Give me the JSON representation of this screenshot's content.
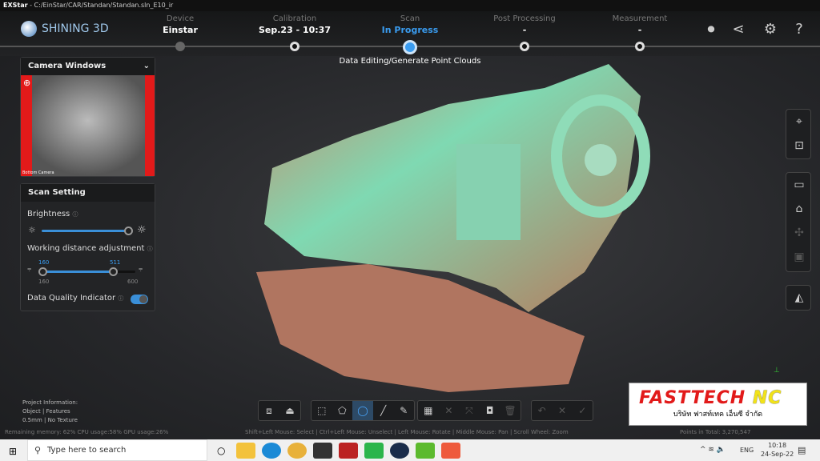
{
  "window": {
    "app": "EXStar",
    "path": "- C:/EinStar/CAR/Standan/Standan.sln_E10_ir"
  },
  "brand": "SHINING 3D",
  "steps": [
    {
      "caption": "Device",
      "value": "Einstar",
      "state": "done"
    },
    {
      "caption": "Calibration",
      "value": "Sep.23 - 10:37",
      "state": "done"
    },
    {
      "caption": "Scan",
      "value": "In Progress",
      "state": "active"
    },
    {
      "caption": "Post Processing",
      "value": "-",
      "state": "pending"
    },
    {
      "caption": "Measurement",
      "value": "-",
      "state": "pending"
    }
  ],
  "step_subtitle": "Data Editing/Generate Point Clouds",
  "header_icons": [
    "record-icon",
    "share-icon",
    "settings-icon",
    "help-icon"
  ],
  "camera_panel": {
    "title": "Camera Windows",
    "image_caption": "Bottom Camera"
  },
  "scan_setting": {
    "title": "Scan Setting",
    "brightness_label": "Brightness",
    "brightness_level": 0.97,
    "working_distance_label": "Working distance adjustment",
    "wd_min": "160",
    "wd_max": "600",
    "wd_low": "160",
    "wd_high": "511",
    "dqi_label": "Data Quality Indicator",
    "dqi_on": true
  },
  "project_info": [
    "Project Information:",
    "Object | Features",
    "0.5mm | No Texture"
  ],
  "status": {
    "left": "Remaining memory: 62% CPU usage:58% GPU usage:26%",
    "center": "Shift+Left Mouse: Select | Ctrl+Left Mouse: Unselect | Left Mouse: Rotate | Middle Mouse: Pan | Scroll Wheel: Zoom",
    "right": "Points in Total: 3,270,547"
  },
  "watermark": {
    "line1": "FASTTECH NC",
    "line2": "บริษัท ฟาสท์เทค เอ็นซี จำกัด"
  },
  "accent": "#3a8fd8",
  "taskbar": {
    "search_placeholder": "Type here to search",
    "lang": "ENG",
    "time": "10:18",
    "date": "24-Sep-22"
  }
}
